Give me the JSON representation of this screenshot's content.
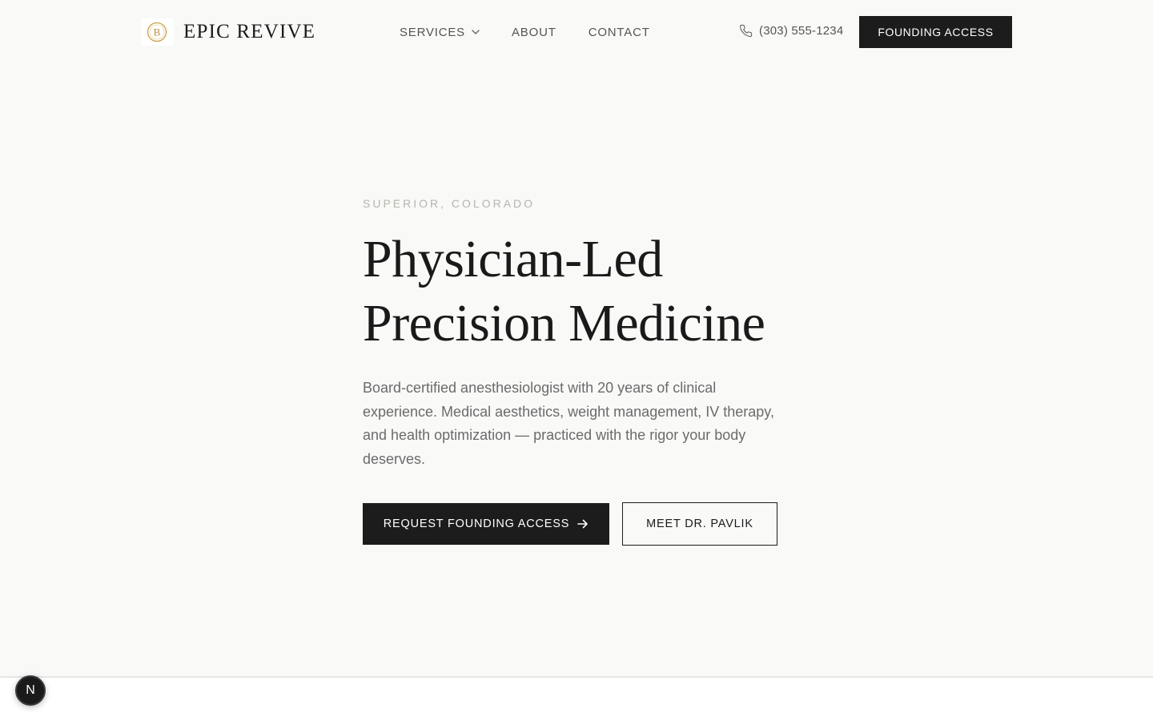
{
  "brand": {
    "name": "EPIC REVIVE",
    "logo_letter": "B",
    "logo_color": "#c9a24a"
  },
  "nav": {
    "items": [
      {
        "label": "SERVICES",
        "has_dropdown": true,
        "icon": "chevron-down-icon"
      },
      {
        "label": "ABOUT"
      },
      {
        "label": "CONTACT"
      }
    ]
  },
  "header": {
    "phone_icon": "phone-icon",
    "phone": "(303) 555-1234",
    "cta_label": "FOUNDING ACCESS"
  },
  "hero": {
    "eyebrow": "SUPERIOR, COLORADO",
    "headline_line1": "Physician-Led",
    "headline_line2": "Precision Medicine",
    "lead": "Board-certified anesthesiologist with 20 years of clinical experience. Medical aesthetics, weight management, IV therapy, and health optimization — practiced with the rigor your body deserves.",
    "primary_label": "REQUEST FOUNDING ACCESS",
    "primary_icon": "arrow-right-icon",
    "secondary_label": "MEET DR. PAVLIK"
  },
  "dev_badge": {
    "letter": "N"
  },
  "colors": {
    "background": "#f9f9f8",
    "ink": "#1c1c1c",
    "muted": "#6b6b6b",
    "eyebrow": "#b4b6ae"
  }
}
